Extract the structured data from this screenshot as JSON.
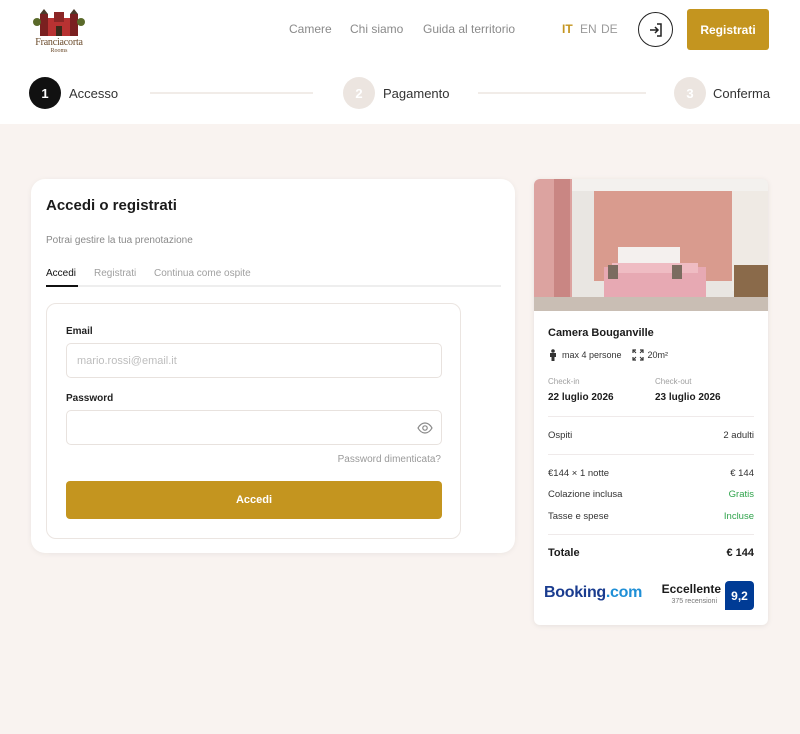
{
  "brand": {
    "logo_text": "Franciacorta",
    "logo_sub": "Rooms"
  },
  "nav": {
    "items": [
      "Camere",
      "Chi siamo",
      "Guida al territorio"
    ]
  },
  "languages": {
    "items": [
      "IT",
      "EN",
      "DE"
    ],
    "active": "IT"
  },
  "header": {
    "login_icon": "login-arrow-icon",
    "register_label": "Registrati"
  },
  "stepper": {
    "steps": [
      {
        "number": "1",
        "label": "Accesso",
        "state": "active"
      },
      {
        "number": "2",
        "label": "Pagamento",
        "state": "inactive"
      },
      {
        "number": "3",
        "label": "Conferma",
        "state": "inactive"
      }
    ]
  },
  "login": {
    "title": "Accedi o registrati",
    "subtitle": "Potrai gestire la tua prenotazione",
    "tabs": [
      "Accedi",
      "Registrati",
      "Continua come ospite"
    ],
    "active_tab": "Accedi",
    "email_label": "Email",
    "email_placeholder": "mario.rossi@email.it",
    "password_label": "Password",
    "password_value": "",
    "forgot_label": "Password dimenticata?",
    "submit_label": "Accedi"
  },
  "summary": {
    "room_name": "Camera Bouganville",
    "capacity": "max 4 persone",
    "size": "20m²",
    "checkin_label": "Check-in",
    "checkin_value": "22 luglio 2026",
    "checkout_label": "Check-out",
    "checkout_value": "23 luglio 2026",
    "guests_label": "Ospiti",
    "guests_value": "2 adulti",
    "lines": [
      {
        "label": "€144 × 1 notte",
        "value": "€ 144",
        "highlight": false
      },
      {
        "label": "Colazione inclusa",
        "value": "Gratis",
        "highlight": true
      },
      {
        "label": "Tasse e spese",
        "value": "Incluse",
        "highlight": true
      }
    ],
    "total_label": "Totale",
    "total_value": "€ 144",
    "booking_brand": "Booking",
    "booking_domain": ".com",
    "rating_label": "Eccellente",
    "reviews": "375 recensioni",
    "score": "9,2"
  },
  "colors": {
    "accent": "#c4951f",
    "background": "#f9f3f0",
    "green": "#2fa34b",
    "booking_blue": "#003b95"
  }
}
